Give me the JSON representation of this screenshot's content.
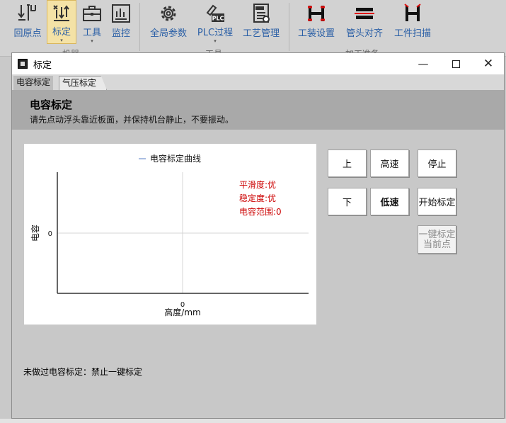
{
  "ribbon": {
    "buttons": [
      {
        "label": "回原点",
        "icon": "home-axis-icon"
      },
      {
        "label": "标定",
        "icon": "calibrate-icon"
      },
      {
        "label": "工具",
        "icon": "toolbox-icon"
      },
      {
        "label": "监控",
        "icon": "monitor-icon"
      },
      {
        "label": "全局参数",
        "icon": "gear-icon"
      },
      {
        "label": "PLC过程",
        "icon": "plc-icon"
      },
      {
        "label": "工艺管理",
        "icon": "lcm-doc-icon"
      },
      {
        "label": "工装设置",
        "icon": "fixture-icon"
      },
      {
        "label": "管头对齐",
        "icon": "pipe-align-icon"
      },
      {
        "label": "工件扫描",
        "icon": "scan-icon"
      }
    ],
    "groups": [
      "机器",
      "工具",
      "加工准备"
    ]
  },
  "dialog": {
    "title": "标定",
    "tabs": [
      "电容标定",
      "气压标定"
    ],
    "heading": "电容标定",
    "subheading": "请先点动浮头靠近板面，并保持机台静止，不要振动。",
    "status": "未做过电容标定：禁止一键标定"
  },
  "controls": {
    "up": "上",
    "high_speed": "高速",
    "stop": "停止",
    "down": "下",
    "low_speed": "低速",
    "start_calibration": "开始标定",
    "one_key_line1": "一键标定",
    "one_key_line2": "当前点"
  },
  "chart_data": {
    "type": "line",
    "series": [
      {
        "name": "电容标定曲线",
        "x": [],
        "y": [],
        "color": "#8fa8d8"
      }
    ],
    "xlabel": "高度/mm",
    "ylabel": "电容",
    "x_ticks": [
      "0"
    ],
    "y_ticks": [
      "0"
    ],
    "annotations": [
      "平滑度:优",
      "稳定度:优",
      "电容范围:0"
    ],
    "annotation_color": "#cc0000",
    "grid": false
  },
  "colors": {
    "ribbon_label": "#2a5fa6",
    "active_button_bg": "#f4e2a6",
    "header_band": "#a9a9a9"
  }
}
